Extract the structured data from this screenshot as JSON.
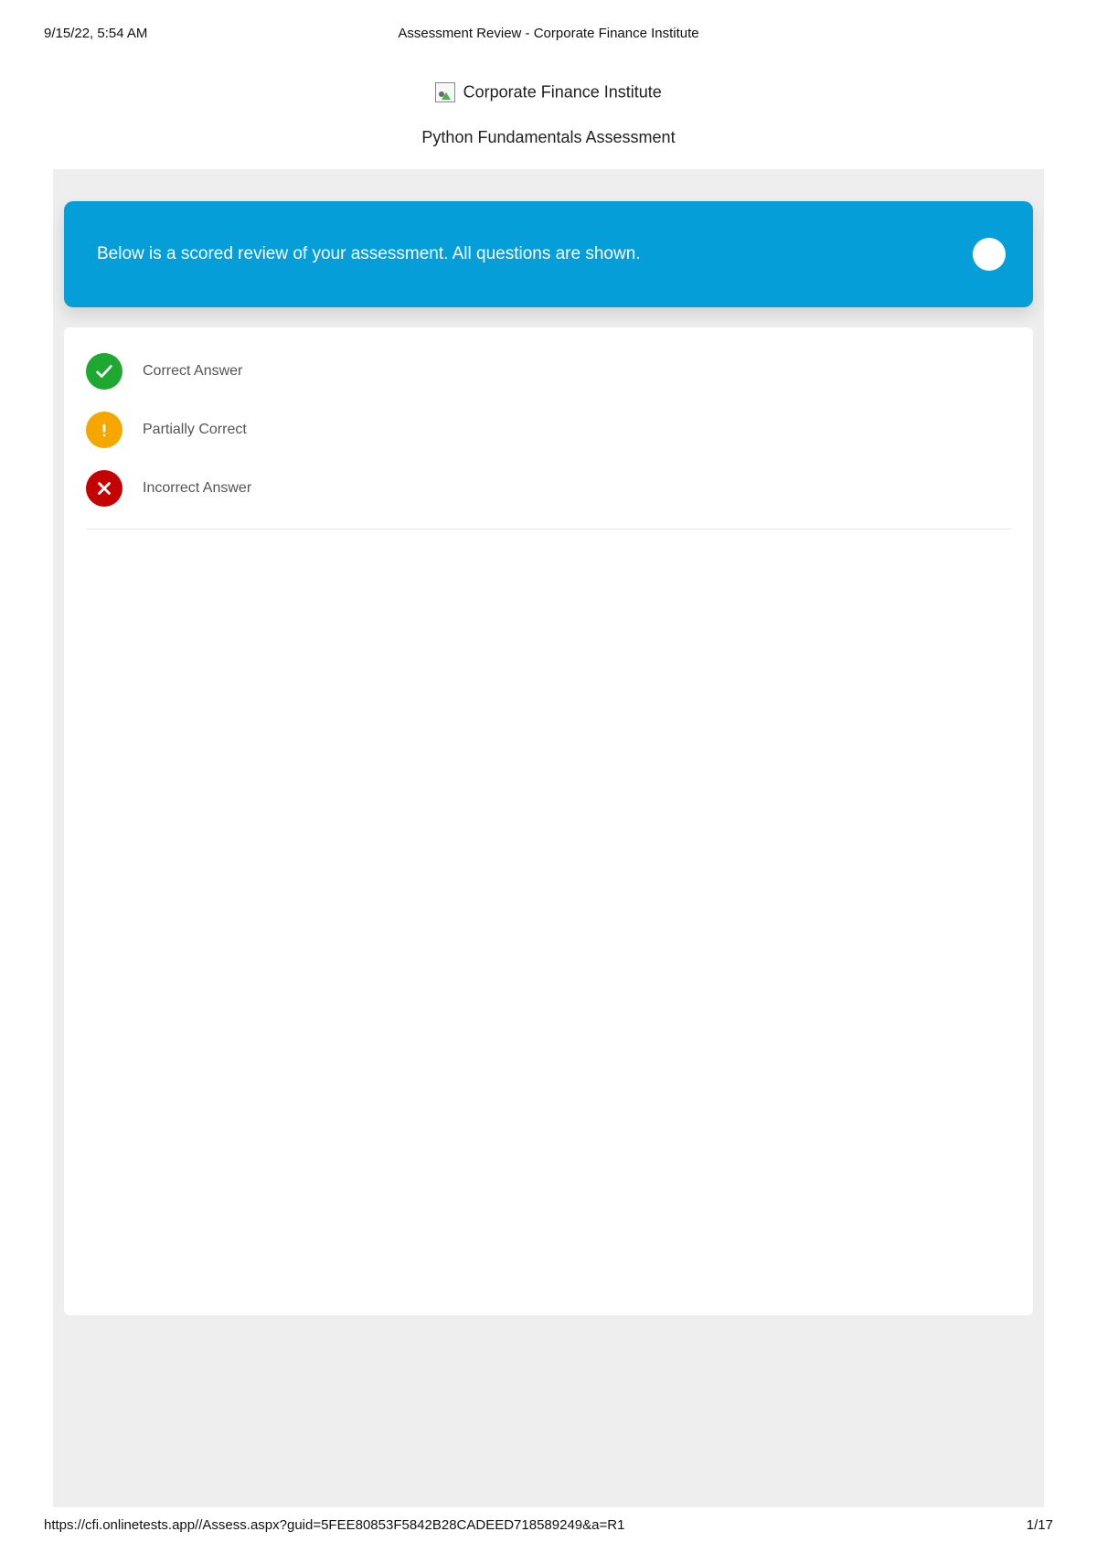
{
  "print_header": {
    "timestamp": "9/15/22, 5:54 AM",
    "doc_title": "Assessment Review - Corporate Finance Institute"
  },
  "logo": {
    "alt_text": "Corporate Finance Institute"
  },
  "assessment_title": "Python Fundamentals Assessment",
  "banner": {
    "text": "Below is a scored review of your assessment. All questions are shown."
  },
  "legend": {
    "items": [
      {
        "key": "correct",
        "label": "Correct Answer"
      },
      {
        "key": "partial",
        "label": "Partially Correct"
      },
      {
        "key": "incorrect",
        "label": "Incorrect Answer"
      }
    ]
  },
  "print_footer": {
    "url": "https://cfi.onlinetests.app//Assess.aspx?guid=5FEE80853F5842B28CADEED718589249&a=R1",
    "page": "1/17"
  },
  "colors": {
    "banner_bg": "#069ed9",
    "correct": "#1fa82f",
    "partial": "#f5a700",
    "incorrect": "#c40202",
    "page_bg": "#eeeeee"
  }
}
